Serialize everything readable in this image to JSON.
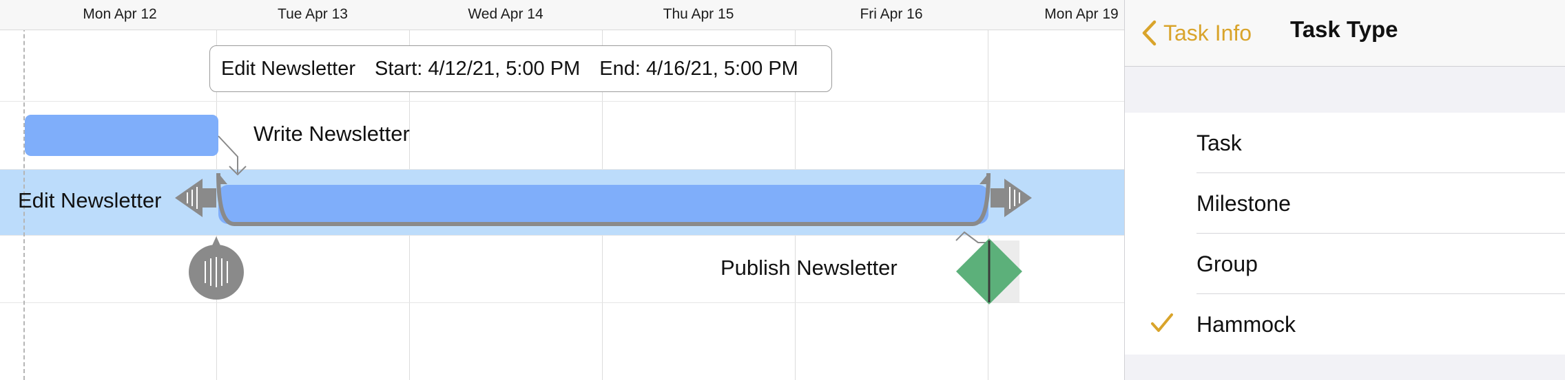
{
  "gantt": {
    "dates": [
      "Mon Apr 12",
      "Tue Apr 13",
      "Wed Apr 14",
      "Thu Apr 15",
      "Fri Apr 16",
      "Mon Apr 19"
    ],
    "tooltip": {
      "name": "Edit Newsletter",
      "start": "Start: 4/12/21, 5:00 PM",
      "end": "End: 4/16/21, 5:00 PM"
    },
    "tasks": {
      "write": "Write Newsletter",
      "edit": "Edit Newsletter",
      "publish": "Publish Newsletter"
    },
    "colors": {
      "task_bar": "#7faefa",
      "selected_row": "#bcdcfb",
      "milestone": "#5cb07a",
      "handle": "#8a8a8a"
    }
  },
  "panel": {
    "back_label": "Task Info",
    "title": "Task Type",
    "accent": "#d9a42b",
    "options": [
      {
        "label": "Task",
        "selected": false
      },
      {
        "label": "Milestone",
        "selected": false
      },
      {
        "label": "Group",
        "selected": false
      },
      {
        "label": "Hammock",
        "selected": true
      }
    ]
  }
}
